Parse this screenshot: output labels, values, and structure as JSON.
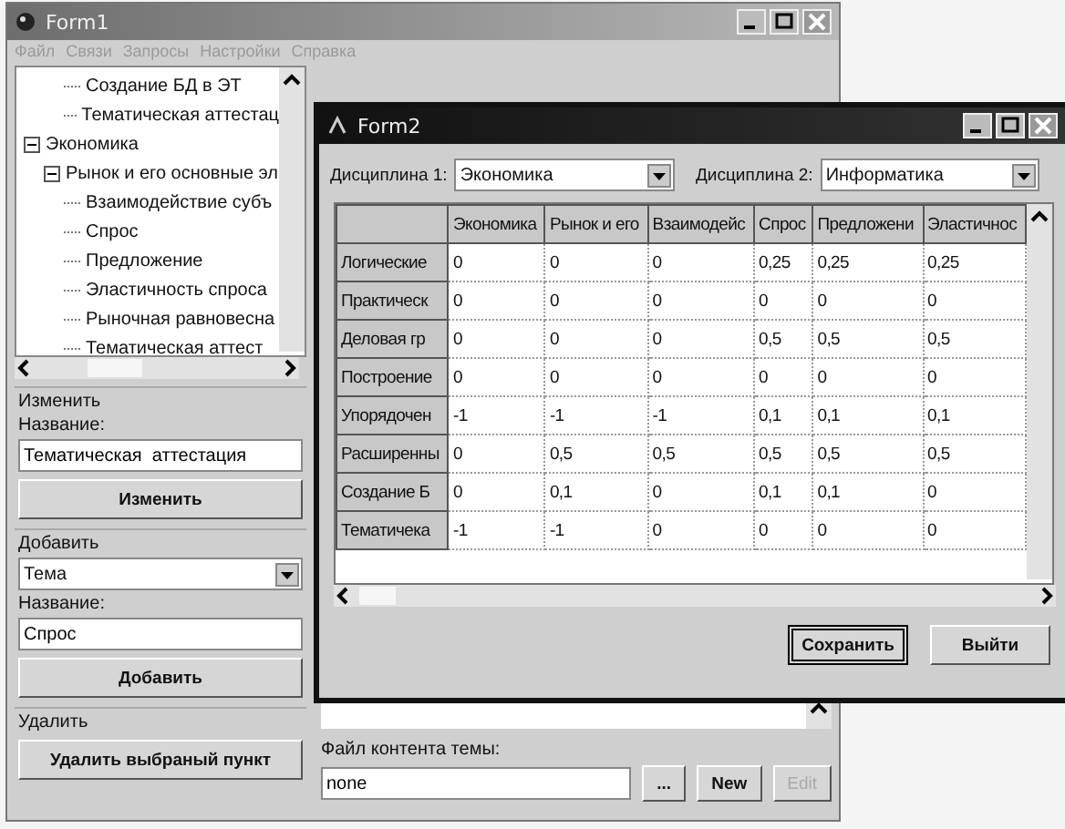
{
  "form1": {
    "title": "Form1",
    "menu": [
      "Файл",
      "Связи",
      "Запросы",
      "Настройки",
      "Справка"
    ],
    "tree": [
      {
        "children": [
          {
            "children": [
              {
                "label": "Создание БД в ЭТ"
              },
              {
                "label": "Тематическая аттестац"
              }
            ]
          }
        ]
      },
      {
        "label": "Экономика",
        "expanded": true,
        "children": [
          {
            "label": "Рынок и его основные эл",
            "expanded": true,
            "children": [
              {
                "label": "Взаимодействие субъ"
              },
              {
                "label": "Спрос"
              },
              {
                "label": "Предложение"
              },
              {
                "label": "Эластичность спроса"
              },
              {
                "label": "Рыночная равновесна"
              },
              {
                "label": "Тематическая  аттест"
              }
            ]
          }
        ]
      }
    ],
    "edit_group": {
      "title": "Изменить",
      "name_label": "Название:",
      "name_value": "Тематическая  аттестация",
      "button": "Изменить"
    },
    "add_group": {
      "title": "Добавить",
      "type_value": "Тема",
      "name_label": "Название:",
      "name_value": "Спрос",
      "button": "Добавить"
    },
    "delete_group": {
      "title": "Удалить",
      "button": "Удалить выбраный пункт"
    },
    "content_file": {
      "label": "Файл контента темы:",
      "value": "none",
      "buttons": [
        {
          "label": "...",
          "disabled": false
        },
        {
          "label": "New",
          "disabled": false
        },
        {
          "label": "Edit",
          "disabled": true
        }
      ]
    }
  },
  "form2": {
    "title": "Form2",
    "discipline1": {
      "label": "Дисциплина 1:",
      "value": "Экономика"
    },
    "discipline2": {
      "label": "Дисциплина 2:",
      "value": "Информатика"
    },
    "table": {
      "columns": [
        "Экономика",
        "Рынок и его",
        "Взаимодейс",
        "Спрос",
        "Предложени",
        "Эластичнос"
      ],
      "rows": [
        {
          "header": "Логические",
          "cells": [
            "0",
            "0",
            "0",
            "0,25",
            "0,25",
            "0,25"
          ]
        },
        {
          "header": "Практическ",
          "cells": [
            "0",
            "0",
            "0",
            "0",
            "0",
            "0"
          ]
        },
        {
          "header": "Деловая гр",
          "cells": [
            "0",
            "0",
            "0",
            "0,5",
            "0,5",
            "0,5"
          ]
        },
        {
          "header": "Построение",
          "cells": [
            "0",
            "0",
            "0",
            "0",
            "0",
            "0"
          ]
        },
        {
          "header": "Упорядочен",
          "cells": [
            "-1",
            "-1",
            "-1",
            "0,1",
            "0,1",
            "0,1"
          ]
        },
        {
          "header": "Расширенны",
          "cells": [
            "0",
            "0,5",
            "0,5",
            "0,5",
            "0,5",
            "0,5"
          ]
        },
        {
          "header": "Создание Б",
          "cells": [
            "0",
            "0,1",
            "0",
            "0,1",
            "0,1",
            "0"
          ]
        },
        {
          "header": "Тематичека",
          "cells": [
            "-1",
            "-1",
            "0",
            "0",
            "0",
            "0"
          ]
        }
      ]
    },
    "buttons": [
      {
        "label": "Сохранить",
        "default": true
      },
      {
        "label": "Выйти",
        "default": false
      }
    ]
  }
}
